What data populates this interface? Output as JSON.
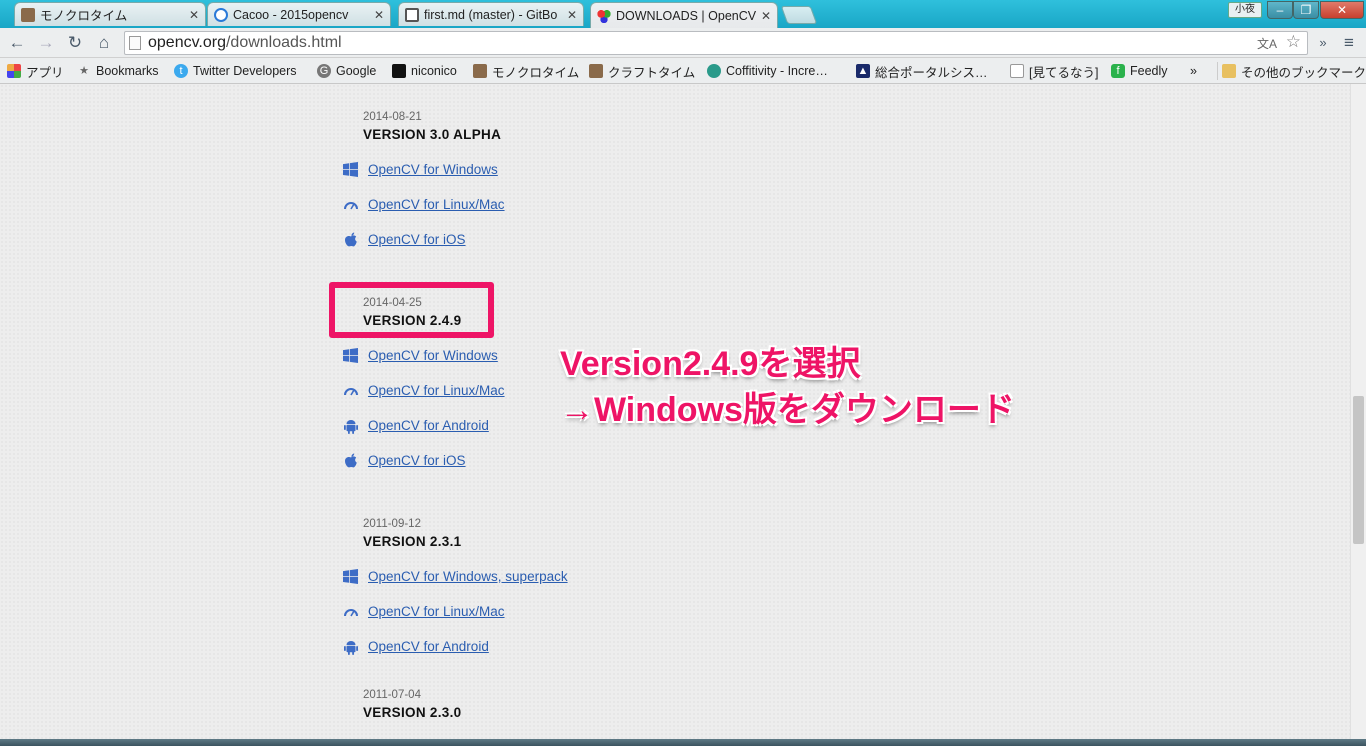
{
  "tabs": [
    {
      "title": "モノクロタイム",
      "icon_color": "#8a6a4a"
    },
    {
      "title": "Cacoo - 2015opencv",
      "icon_color": "#2a7ad8"
    },
    {
      "title": "first.md (master) - GitBo",
      "icon_color": "#555555"
    },
    {
      "title": "DOWNLOADS | OpenCV",
      "icon_color": "#c33"
    }
  ],
  "window": {
    "user": "小夜",
    "minimize": "‒",
    "restore": "❐",
    "close": "✕"
  },
  "address": {
    "host": "opencv.org",
    "path": "/downloads.html"
  },
  "bookmarks": [
    {
      "label": "アプリ",
      "icon": "apps-icon"
    },
    {
      "label": "Bookmarks",
      "icon": "star-icon"
    },
    {
      "label": "Twitter Developers",
      "icon": "twitter-icon"
    },
    {
      "label": "Google",
      "icon": "google-icon"
    },
    {
      "label": "niconico",
      "icon": "niconico-icon"
    },
    {
      "label": "モノクロタイム",
      "icon": "site-icon"
    },
    {
      "label": "クラフトタイム",
      "icon": "site-icon"
    },
    {
      "label": "Coffitivity - Incre…",
      "icon": "coffitivity-icon"
    },
    {
      "label": "総合ポータルシス…",
      "icon": "graduation-icon"
    },
    {
      "label": "[見てるなう]",
      "icon": "page-icon"
    },
    {
      "label": "Feedly",
      "icon": "feedly-icon"
    }
  ],
  "bookmarks_overflow": "»",
  "other_bookmarks": "その他のブックマーク",
  "releases": [
    {
      "date": "2014-08-21",
      "version": "VERSION 3.0 ALPHA",
      "links": [
        {
          "label": "OpenCV for Windows",
          "os": "windows"
        },
        {
          "label": "OpenCV for Linux/Mac",
          "os": "linux"
        },
        {
          "label": "OpenCV for iOS",
          "os": "apple"
        }
      ]
    },
    {
      "date": "2014-04-25",
      "version": "VERSION 2.4.9",
      "links": [
        {
          "label": "OpenCV for Windows",
          "os": "windows"
        },
        {
          "label": "OpenCV for Linux/Mac",
          "os": "linux"
        },
        {
          "label": "OpenCV for Android",
          "os": "android"
        },
        {
          "label": "OpenCV for iOS",
          "os": "apple"
        }
      ]
    },
    {
      "date": "2011-09-12",
      "version": "VERSION 2.3.1",
      "links": [
        {
          "label": "OpenCV for Windows, superpack",
          "os": "windows"
        },
        {
          "label": "OpenCV for Linux/Mac",
          "os": "linux"
        },
        {
          "label": "OpenCV for Android",
          "os": "android"
        }
      ]
    },
    {
      "date": "2011-07-04",
      "version": "VERSION 2.3.0",
      "links": []
    }
  ],
  "annotation": {
    "line1": "Version2.4.9を選択",
    "line2": "→Windows版をダウンロード",
    "color": "#ee1466"
  }
}
